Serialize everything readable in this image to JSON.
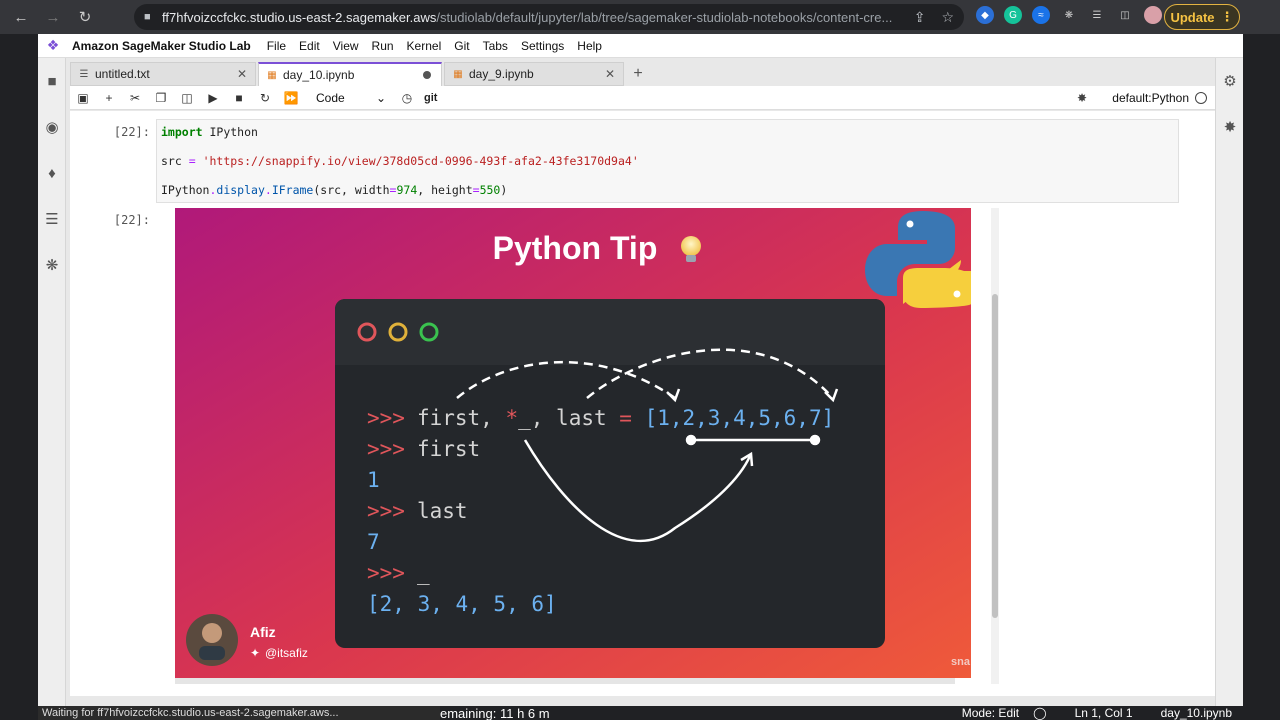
{
  "browser": {
    "url_host": "ff7hfvoizccfckc.studio.us-east-2.sagemaker.aws",
    "url_path": "/studiolab/default/jupyter/lab/tree/sagemaker-studiolab-notebooks/content-cre...",
    "update_label": "Update"
  },
  "app": {
    "name": "Amazon SageMaker Studio Lab",
    "menu": [
      "File",
      "Edit",
      "View",
      "Run",
      "Kernel",
      "Git",
      "Tabs",
      "Settings",
      "Help"
    ]
  },
  "tabs": [
    {
      "label": "untitled.txt",
      "active": false
    },
    {
      "label": "day_10.ipynb",
      "active": true
    },
    {
      "label": "day_9.ipynb",
      "active": false
    }
  ],
  "toolbar": {
    "cell_type": "Code",
    "git_label": "git",
    "kernel_name": "default:Python"
  },
  "cell": {
    "in_prompt": "[22]:",
    "out_prompt": "[22]:",
    "line1_kw": "import",
    "line1_rest": " IPython",
    "line2_var": "src",
    "line2_eq": " = ",
    "line2_str": "'https://snappify.io/view/378d05cd-0996-493f-afa2-43fe3170d9a4'",
    "line3_a": "IPython",
    "line3_b": ".",
    "line3_c": "display",
    "line3_d": ".",
    "line3_e": "IFrame",
    "line3_f": "(src, width",
    "line3_g": "=",
    "line3_h": "974",
    "line3_i": ", height",
    "line3_j": "=",
    "line3_k": "550",
    "line3_l": ")"
  },
  "output": {
    "title": "Python Tip",
    "code_lines": [
      {
        "prompt": ">>>",
        "text": "first, ",
        "star": "*",
        "underscore": "_",
        "rest": ", last ",
        "eq": "=",
        "list": " [1,2,3,4,5,6,7]"
      },
      {
        "prompt": ">>>",
        "text": "first"
      },
      {
        "value": "1"
      },
      {
        "prompt": ">>>",
        "text": "last"
      },
      {
        "value": "7"
      },
      {
        "prompt": ">>>",
        "text": "_"
      },
      {
        "value": "[2, 3, 4, 5, 6]"
      }
    ],
    "author_name": "Afiz",
    "author_handle": "@itsafiz",
    "watermark": "sna"
  },
  "status": {
    "loading": "Waiting for ff7hfvoizccfckc.studio.us-east-2.sagemaker.aws...",
    "remaining": "emaining: 11 h 6 m",
    "mode": "Mode: Edit",
    "position": "Ln 1, Col 1",
    "file": "day_10.ipynb"
  },
  "colors": {
    "brand": "#7b4fd6",
    "chrome": "#35363a",
    "prompt_red": "#e0565b",
    "number_blue": "#6cb1f0"
  }
}
